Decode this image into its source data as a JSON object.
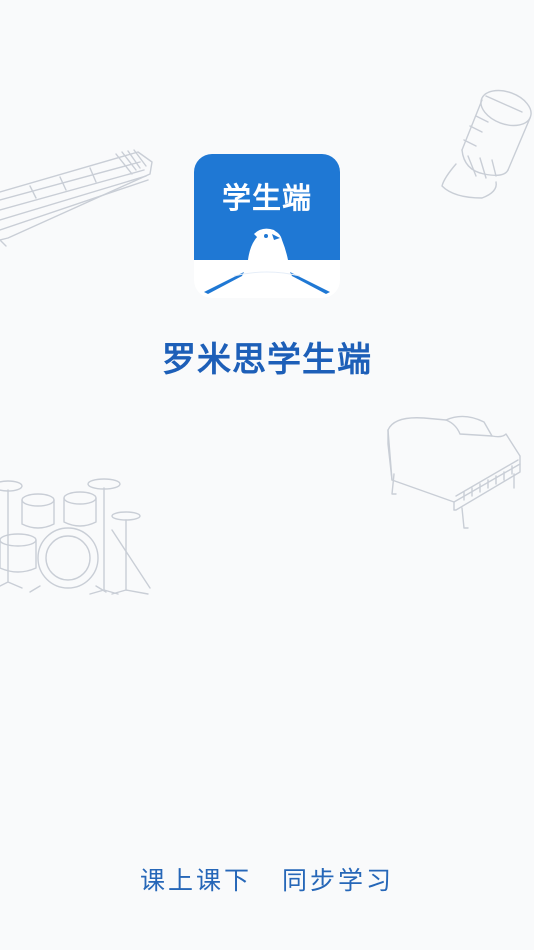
{
  "splash": {
    "icon_label": "学生端",
    "app_name": "罗米思学生端",
    "slogan_left": "课上课下",
    "slogan_right": "同步学习"
  },
  "icons": {
    "eagle": "eagle-logo-icon",
    "guzheng": "guzheng-icon",
    "hand-drum": "hand-drum-icon",
    "piano": "grand-piano-icon",
    "drum-kit": "drum-kit-icon"
  },
  "colors": {
    "brand_blue": "#1f78d4",
    "text_blue": "#1d5fb8",
    "background": "#f9fafb",
    "sketch_line": "#c9ced6"
  }
}
